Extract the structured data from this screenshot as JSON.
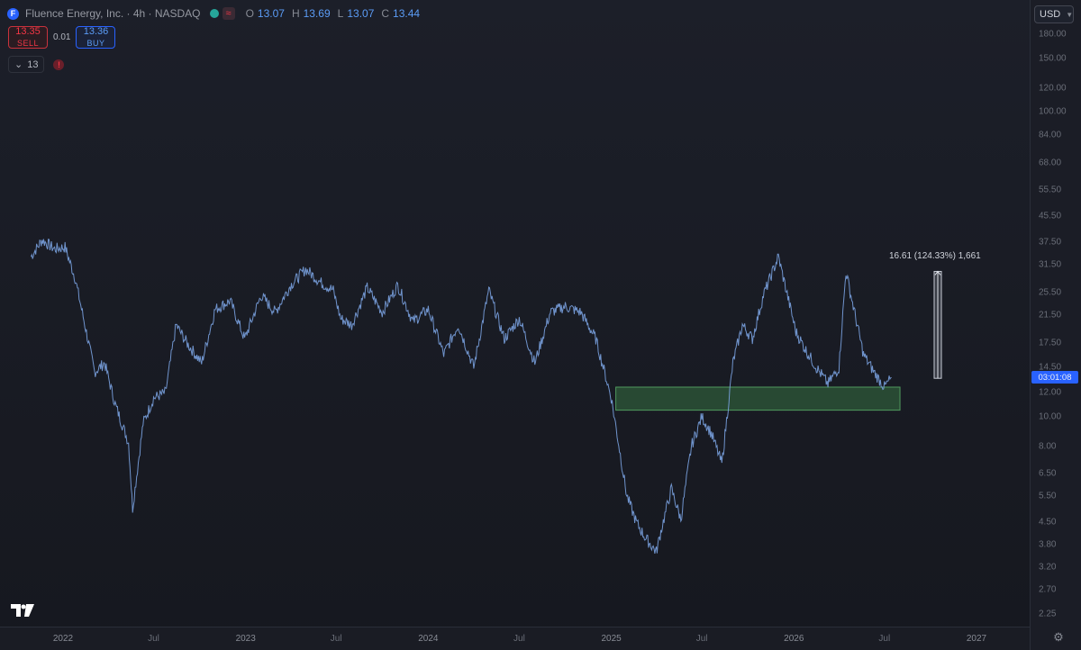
{
  "header": {
    "logo_letter": "F",
    "title": "Fluence Energy, Inc. · 4h · NASDAQ",
    "status_chip": "≈",
    "ohlc": {
      "o_label": "O",
      "o": "13.07",
      "h_label": "H",
      "h": "13.69",
      "l_label": "L",
      "l": "13.07",
      "c_label": "C",
      "c": "13.44"
    }
  },
  "trade": {
    "sell_price": "13.35",
    "sell_label": "SELL",
    "spread": "0.01",
    "buy_price": "13.36",
    "buy_label": "BUY"
  },
  "indicators": {
    "count": "13",
    "warning_icon": "!"
  },
  "price_axis": {
    "currency": "USD",
    "current_price_label": "03:01:08"
  },
  "measure": {
    "label": "16.61 (124.33%) 1,661"
  },
  "colors": {
    "background": "#1a1c25",
    "line": "#7aa2e0",
    "zone_fill": "#2e5a3a",
    "zone_border": "#4f9a5e",
    "accent": "#2962ff"
  },
  "chart_data": {
    "type": "line",
    "scale": "log",
    "title": "",
    "ylim": [
      2.0,
      190.0
    ],
    "y_ticks": [
      "180.00",
      "150.00",
      "120.00",
      "100.00",
      "84.00",
      "68.00",
      "55.50",
      "45.50",
      "37.50",
      "31.50",
      "25.50",
      "21.50",
      "17.50",
      "14.50",
      "12.00",
      "10.00",
      "8.00",
      "6.50",
      "5.50",
      "4.50",
      "3.80",
      "3.20",
      "2.70",
      "2.25"
    ],
    "x_ticks": [
      "2022",
      "Jul",
      "2023",
      "Jul",
      "2024",
      "Jul",
      "2025",
      "Jul",
      "2026",
      "Jul",
      "2027"
    ],
    "series": [
      {
        "x": [
          "2021-10-29",
          "2021-11-20",
          "2021-12-15",
          "2022-01-05",
          "2022-01-25",
          "2022-02-15",
          "2022-03-05",
          "2022-03-25",
          "2022-04-15",
          "2022-05-12",
          "2022-05-20",
          "2022-06-10",
          "2022-07-01",
          "2022-07-25",
          "2022-08-15",
          "2022-09-05",
          "2022-10-05",
          "2022-11-01",
          "2022-12-01",
          "2022-12-30",
          "2023-02-01",
          "2023-03-01",
          "2023-04-01",
          "2023-05-01",
          "2023-06-01",
          "2023-06-25",
          "2023-07-10",
          "2023-08-01",
          "2023-09-01",
          "2023-10-01",
          "2023-11-01",
          "2023-12-01",
          "2024-01-01",
          "2024-02-01",
          "2024-03-01",
          "2024-04-01",
          "2024-05-01",
          "2024-06-01",
          "2024-07-01",
          "2024-08-01",
          "2024-09-01",
          "2024-10-01",
          "2024-11-01",
          "2024-12-01",
          "2025-01-01",
          "2025-02-01",
          "2025-02-20",
          "2025-03-10",
          "2025-04-01",
          "2025-04-10",
          "2025-05-01",
          "2025-05-20",
          "2025-06-10",
          "2025-07-01",
          "2025-07-20",
          "2025-08-10",
          "2025-09-01",
          "2025-09-20",
          "2025-10-10",
          "2025-11-01",
          "2025-12-01",
          "2026-01-05",
          "2026-01-25",
          "2026-02-15",
          "2026-03-10",
          "2026-04-01",
          "2026-04-15",
          "2026-04-25",
          "2026-05-20",
          "2026-06-10",
          "2026-07-01",
          "2026-07-15"
        ],
        "y": [
          33.5,
          38.0,
          35.5,
          36.0,
          28.5,
          19.5,
          14.0,
          15.0,
          11.0,
          8.2,
          5.0,
          9.5,
          11.5,
          12.0,
          20.0,
          17.5,
          15.0,
          22.5,
          24.0,
          18.0,
          25.0,
          22.0,
          27.0,
          30.5,
          27.5,
          26.0,
          21.0,
          20.0,
          26.5,
          22.0,
          27.0,
          20.5,
          22.5,
          16.0,
          20.0,
          14.5,
          26.0,
          18.0,
          21.0,
          15.0,
          22.0,
          23.0,
          22.0,
          18.0,
          11.5,
          5.5,
          4.5,
          4.0,
          3.6,
          4.2,
          5.8,
          4.6,
          8.0,
          10.0,
          8.8,
          7.0,
          15.0,
          20.0,
          18.0,
          25.0,
          33.5,
          19.0,
          16.5,
          14.5,
          12.8,
          14.5,
          30.0,
          25.0,
          16.0,
          14.0,
          12.5,
          13.44
        ]
      }
    ],
    "zone": {
      "price_low": 10.5,
      "price_high": 12.5,
      "x_start": "2025-01-10",
      "x_end": "2026-08-01"
    },
    "measurement": {
      "from": 13.36,
      "to": 29.97,
      "change": 16.61,
      "percent": 124.33,
      "ticks": 1661
    },
    "current_price": 13.44
  }
}
